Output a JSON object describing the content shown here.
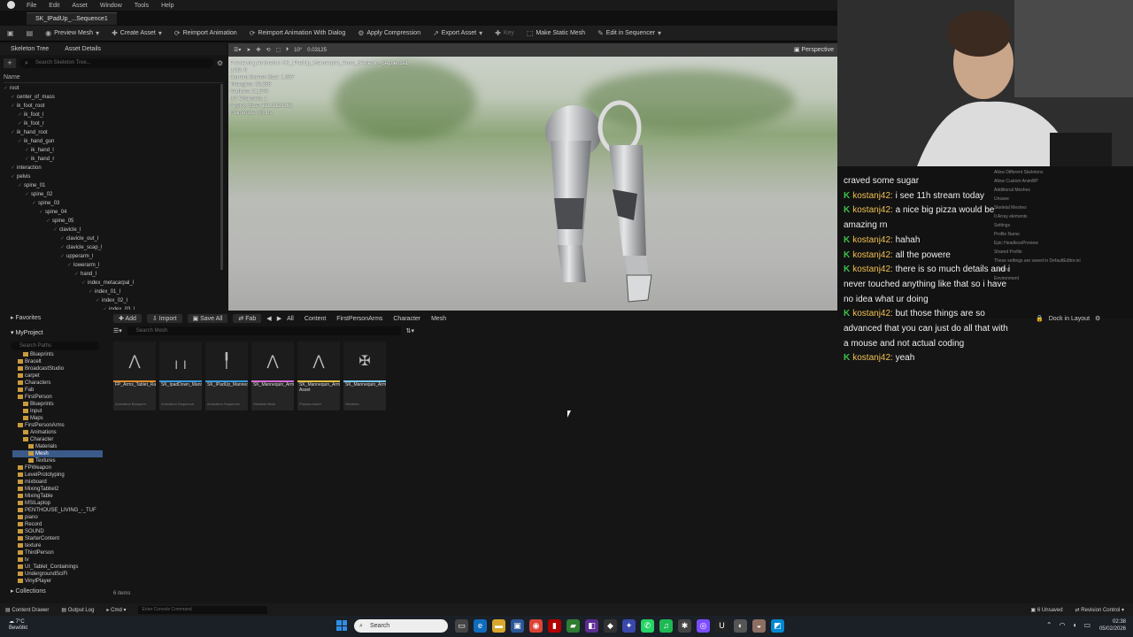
{
  "menu": [
    "File",
    "Edit",
    "Asset",
    "Window",
    "Tools",
    "Help"
  ],
  "doc_tab": "SK_IPadUp_...Sequence1",
  "toolbar": {
    "preview_mesh": "Preview Mesh",
    "create_asset": "Create Asset",
    "reimport": "Reimport Animation",
    "reimport_dialog": "Reimport Animation With Dialog",
    "apply_compression": "Apply Compression",
    "export_asset": "Export Asset",
    "key": "Key",
    "make_static": "Make Static Mesh",
    "edit_sequencer": "Edit in Sequencer"
  },
  "left_panel": {
    "tab1": "Skeleton Tree",
    "tab2": "Asset Details",
    "search_placeholder": "Search Skeleton Tree...",
    "name_header": "Name"
  },
  "bones": [
    {
      "n": "root",
      "d": 0
    },
    {
      "n": "center_of_mass",
      "d": 1
    },
    {
      "n": "ik_foot_root",
      "d": 1
    },
    {
      "n": "ik_foot_l",
      "d": 2
    },
    {
      "n": "ik_foot_r",
      "d": 2
    },
    {
      "n": "ik_hand_root",
      "d": 1
    },
    {
      "n": "ik_hand_gun",
      "d": 2
    },
    {
      "n": "ik_hand_l",
      "d": 3
    },
    {
      "n": "ik_hand_r",
      "d": 3
    },
    {
      "n": "interaction",
      "d": 1
    },
    {
      "n": "pelvis",
      "d": 1
    },
    {
      "n": "spine_01",
      "d": 2
    },
    {
      "n": "spine_02",
      "d": 3
    },
    {
      "n": "spine_03",
      "d": 4
    },
    {
      "n": "spine_04",
      "d": 5
    },
    {
      "n": "spine_05",
      "d": 6
    },
    {
      "n": "clavicle_l",
      "d": 7
    },
    {
      "n": "clavicle_out_l",
      "d": 8
    },
    {
      "n": "clavicle_scap_l",
      "d": 8
    },
    {
      "n": "upperarm_l",
      "d": 8
    },
    {
      "n": "lowerarm_l",
      "d": 9
    },
    {
      "n": "hand_l",
      "d": 10
    },
    {
      "n": "index_metacarpal_l",
      "d": 11
    },
    {
      "n": "index_01_l",
      "d": 12
    },
    {
      "n": "index_02_l",
      "d": 13
    },
    {
      "n": "index_03_l",
      "d": 14
    }
  ],
  "viewport": {
    "perspective": "Perspective",
    "previewing": "Previewing Animation SK_IPadUp_Mannequin_Arms_Skeleton_Sequence1",
    "stats": [
      "LOD: 0",
      "Current Screen Size: 1.857",
      "Triangles: 40,258",
      "Vertices: 21,570",
      "UV Channels: 1",
      "Approx Size: 111x112x162",
      "Framerate: 30 fps"
    ],
    "fov": "10°",
    "speed": "0.03125"
  },
  "chat": [
    {
      "user": "",
      "text": "craved some sugar"
    },
    {
      "user": "kostanj42:",
      "text": "i see 11h stream today"
    },
    {
      "user": "kostanj42:",
      "text": "a nice big pizza would be amazing rn"
    },
    {
      "user": "kostanj42:",
      "text": "hahah"
    },
    {
      "user": "kostanj42:",
      "text": "all the powere"
    },
    {
      "user": "kostanj42:",
      "text": "there is so much details and i never touched anything like that so i have no idea what ur doing"
    },
    {
      "user": "kostanj42:",
      "text": "but those things are so advanced that you can just do all that with a mouse and not actual coding"
    },
    {
      "user": "kostanj42:",
      "text": "yeah"
    }
  ],
  "details_ghost": [
    "Allow Different Skeletons",
    "Allow Custom AnimBP",
    "Additional Meshes",
    "Unsave",
    "Skeletal Meshes",
    "0 Array elements",
    "Settings",
    "Profile Name",
    "Epic HeadlessPreview",
    "Shared Profile",
    "These settings are saved in DefaultEditor.ini",
    "Lighting",
    "Environment"
  ],
  "content": {
    "add": "Add",
    "import": "Import",
    "save_all": "Save All",
    "fab": "Fab",
    "all": "All",
    "breadcrumbs": [
      "Content",
      "FirstPersonArms",
      "Character",
      "Mesh"
    ],
    "dock": "Dock in Layout",
    "favorites": "Favorites",
    "project": "MyProject",
    "search_paths": "Search Paths",
    "search_placeholder": "Search Mesh",
    "items_count": "6 items",
    "collections": "Collections"
  },
  "folders": [
    {
      "n": "Blueprints",
      "d": 2
    },
    {
      "n": "Bracelt",
      "d": 1
    },
    {
      "n": "BroadcastStudio",
      "d": 1
    },
    {
      "n": "carpet",
      "d": 1
    },
    {
      "n": "Characters",
      "d": 1
    },
    {
      "n": "Fab",
      "d": 1
    },
    {
      "n": "FirstPerson",
      "d": 1
    },
    {
      "n": "Blueprints",
      "d": 2
    },
    {
      "n": "Input",
      "d": 2
    },
    {
      "n": "Maps",
      "d": 2
    },
    {
      "n": "FirstPersonArms",
      "d": 1
    },
    {
      "n": "Animations",
      "d": 2
    },
    {
      "n": "Character",
      "d": 2
    },
    {
      "n": "Materials",
      "d": 3
    },
    {
      "n": "Mesh",
      "d": 3,
      "sel": true
    },
    {
      "n": "Textures",
      "d": 3
    },
    {
      "n": "FPWeapon",
      "d": 1
    },
    {
      "n": "LevelPrototyping",
      "d": 1
    },
    {
      "n": "mixboard",
      "d": 1
    },
    {
      "n": "MixingTabbel2",
      "d": 1
    },
    {
      "n": "MixingTable",
      "d": 1
    },
    {
      "n": "MSILaptop",
      "d": 1
    },
    {
      "n": "PENTHOUSE_LIVING_-_TUF",
      "d": 1
    },
    {
      "n": "piano",
      "d": 1
    },
    {
      "n": "Record",
      "d": 1
    },
    {
      "n": "SOUND",
      "d": 1
    },
    {
      "n": "StarterContent",
      "d": 1
    },
    {
      "n": "texture",
      "d": 1
    },
    {
      "n": "ThirdPerson",
      "d": 1
    },
    {
      "n": "tv",
      "d": 1
    },
    {
      "n": "UI_Tablet_Containings",
      "d": 1
    },
    {
      "n": "UndergroundSciFi",
      "d": 1
    },
    {
      "n": "VinylPlayer",
      "d": 1
    }
  ],
  "assets": [
    {
      "name": "FP_Arms_Tablet_Raise",
      "type": "Animation Blueprint",
      "color": "#e08a2c",
      "glyph": "⋀"
    },
    {
      "name": "SK_IpadDown_Mannequin_Arms_Skeleton...",
      "type": "Animation Sequence",
      "color": "#3a9ad9",
      "glyph": "╷╷"
    },
    {
      "name": "SK_IPadUp_Mannequin_Arms_Skeleton...",
      "type": "Animation Sequence",
      "color": "#3a9ad9",
      "glyph": "╿"
    },
    {
      "name": "SK_Mannequin_Arms",
      "type": "Skeletal Mesh",
      "color": "#d36bd6",
      "glyph": "⋀"
    },
    {
      "name": "SK_Mannequin_Arms_Physics Asset",
      "type": "Physics Asset",
      "color": "#e0c040",
      "glyph": "⋀"
    },
    {
      "name": "SK_Mannequin_Arms_Skeleton",
      "type": "Skeleton",
      "color": "#77c7e8",
      "glyph": "✠"
    }
  ],
  "statusbar": {
    "drawer": "Content Drawer",
    "output": "Output Log",
    "cmd": "Cmd",
    "cmd_placeholder": "Enter Console Command",
    "unsaved": "6 Unsaved",
    "revision": "Revision Control"
  },
  "taskbar": {
    "weather_temp": "7°C",
    "weather_desc": "Bewölkt",
    "search": "Search",
    "time": "02:38",
    "date": "05/02/2026"
  }
}
